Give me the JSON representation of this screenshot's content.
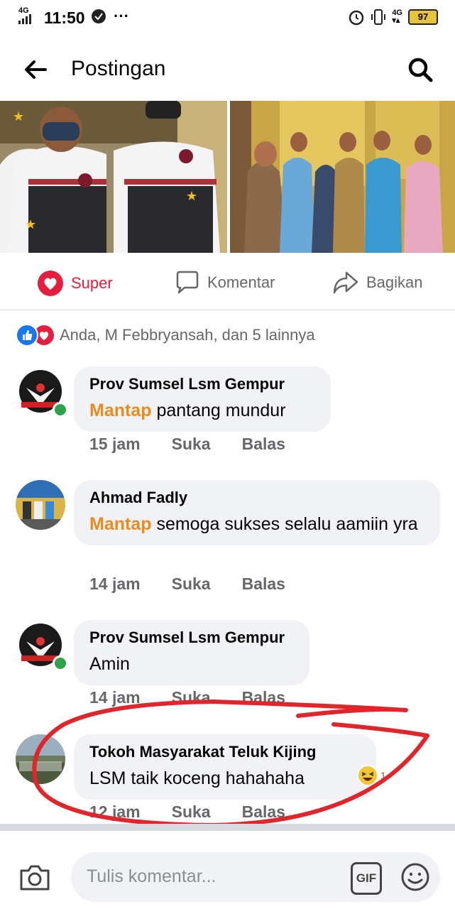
{
  "status_bar": {
    "network": "4G",
    "time": "11:50",
    "dots": "···",
    "network_right": "4G",
    "battery": "97"
  },
  "header": {
    "title": "Postingan"
  },
  "actions": {
    "super": "Super",
    "comment": "Komentar",
    "share": "Bagikan"
  },
  "reactions": {
    "summary": "Anda, M Febbryansah, dan 5 lainnya"
  },
  "comments": [
    {
      "name": "Prov Sumsel Lsm Gempur",
      "keyword": "Mantap",
      "text": " pantang mundur",
      "time": "15 jam",
      "like": "Suka",
      "reply": "Balas"
    },
    {
      "name": "Ahmad Fadly",
      "keyword": "Mantap",
      "text": " semoga sukses selalu aamiin yra",
      "time": "14 jam",
      "like": "Suka",
      "reply": "Balas"
    },
    {
      "name": "Prov Sumsel Lsm Gempur",
      "keyword": "",
      "text": "Amin",
      "time": "14 jam",
      "like": "Suka",
      "reply": "Balas"
    },
    {
      "name": "Tokoh Masyarakat Teluk Kijing",
      "keyword": "",
      "text": "LSM  taik koceng  hahahaha",
      "time": "12 jam",
      "like": "Suka",
      "reply": "Balas",
      "reaction_count": "1"
    }
  ],
  "composer": {
    "placeholder": "Tulis komentar...",
    "gif": "GIF"
  },
  "colors": {
    "super_red": "#e41e3f",
    "keyword_orange": "#e78c1f",
    "annotation_red": "#e0252b",
    "online_green": "#31a24c"
  }
}
